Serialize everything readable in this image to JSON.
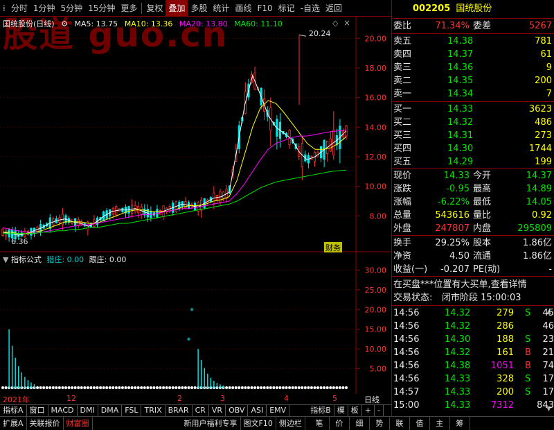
{
  "toolbar": {
    "items": [
      "分时",
      "1分钟",
      "5分钟",
      "15分钟",
      "更多",
      "复权",
      "叠加",
      "多股",
      "统计",
      "画线",
      "F10",
      "标记",
      "-自选",
      "返回"
    ]
  },
  "watermark": "股道 guo.cn",
  "chart_title": {
    "name": "国统股份(日线)",
    "ma5": "MA5: 13.75",
    "ma10": "MA10: 13.36",
    "ma20": "MA20: 13.80",
    "ma60": "MA60: 11.10"
  },
  "price_axis": [
    "20.00",
    "18.00",
    "16.00",
    "14.00",
    "12.00",
    "10.00",
    "8.00"
  ],
  "annotations": {
    "high": "20.24",
    "low": "6.36",
    "badge": "财务"
  },
  "indicator": {
    "title": "指标公式",
    "lie": "猎庄: 0.00",
    "gen": "跟庄: 0.00",
    "axis": [
      "30.00",
      "25.00",
      "20.00",
      "15.00",
      "10.00",
      "5.00"
    ]
  },
  "time_axis": {
    "labels": [
      "2021年",
      "12",
      "2",
      "3",
      "4",
      "5"
    ],
    "right": "日线"
  },
  "ind_tabs": [
    "指标A",
    "窗口",
    "MACD",
    "DMI",
    "DMA",
    "FSL",
    "TRIX",
    "BRAR",
    "CR",
    "VR",
    "OBV",
    "ASI",
    "EMV",
    "指标B",
    "模",
    "板",
    "+",
    "-"
  ],
  "bottom_bar": [
    "扩展A",
    "关联报价",
    "财富圈",
    "新用户福利专享",
    "图文F10",
    "侧边栏",
    "笔",
    "价",
    "细",
    "势",
    "联",
    "值",
    "主",
    "筹"
  ],
  "quote": {
    "code": "002205",
    "name": "国统股份",
    "weibi_label": "委比",
    "weibi": "71.34%",
    "weicha_label": "委差",
    "weicha": "5267",
    "asks": [
      {
        "label": "卖五",
        "price": "14.38",
        "vol": "781"
      },
      {
        "label": "卖四",
        "price": "14.37",
        "vol": "61"
      },
      {
        "label": "卖三",
        "price": "14.36",
        "vol": "9"
      },
      {
        "label": "卖二",
        "price": "14.35",
        "vol": "200"
      },
      {
        "label": "卖一",
        "price": "14.34",
        "vol": "7"
      }
    ],
    "bids": [
      {
        "label": "买一",
        "price": "14.33",
        "vol": "3623"
      },
      {
        "label": "买二",
        "price": "14.32",
        "vol": "486"
      },
      {
        "label": "买三",
        "price": "14.31",
        "vol": "273"
      },
      {
        "label": "买四",
        "price": "14.30",
        "vol": "1744"
      },
      {
        "label": "买五",
        "price": "14.29",
        "vol": "199"
      }
    ],
    "stats": [
      {
        "l1": "现价",
        "v1": "14.33",
        "c1": "green",
        "l2": "今开",
        "v2": "14.37",
        "c2": "green"
      },
      {
        "l1": "涨跌",
        "v1": "-0.95",
        "c1": "green",
        "l2": "最高",
        "v2": "14.89",
        "c2": "green"
      },
      {
        "l1": "涨幅",
        "v1": "-6.22%",
        "c1": "green",
        "l2": "最低",
        "v2": "14.05",
        "c2": "green"
      },
      {
        "l1": "总量",
        "v1": "543616",
        "c1": "yellow",
        "l2": "量比",
        "v2": "0.92",
        "c2": "yellow"
      },
      {
        "l1": "外盘",
        "v1": "247807",
        "c1": "red",
        "l2": "内盘",
        "v2": "295809",
        "c2": "green"
      }
    ],
    "stats2": [
      {
        "l1": "换手",
        "v1": "29.25%",
        "l2": "股本",
        "v2": "1.86亿"
      },
      {
        "l1": "净资",
        "v1": "4.50",
        "l2": "流通",
        "v2": "1.86亿"
      },
      {
        "l1": "收益(一)",
        "v1": "-0.207",
        "l2": "PE(动)",
        "v2": "-"
      }
    ],
    "notice": "在买盘***位置有大买单,查看详情",
    "status_label": "交易状态:",
    "status": "闭市阶段 15:00:03",
    "trades": [
      {
        "t": "14:56",
        "p": "14.32",
        "v": "279",
        "d": "S",
        "n": "45"
      },
      {
        "t": "14:56",
        "p": "14.32",
        "v": "286",
        "d": "",
        "n": "46"
      },
      {
        "t": "14:56",
        "p": "14.30",
        "v": "188",
        "d": "S",
        "n": "23"
      },
      {
        "t": "14:56",
        "p": "14.32",
        "v": "161",
        "d": "B",
        "n": "21"
      },
      {
        "t": "14:56",
        "p": "14.38",
        "v": "1051",
        "d": "B",
        "n": "74"
      },
      {
        "t": "14:56",
        "p": "14.33",
        "v": "328",
        "d": "S",
        "n": "17"
      },
      {
        "t": "14:57",
        "p": "14.33",
        "v": "200",
        "d": "S",
        "n": "17"
      },
      {
        "t": "15:00",
        "p": "14.33",
        "v": "7312",
        "d": "",
        "n": "843"
      }
    ]
  },
  "chart_data": {
    "type": "line",
    "y_range": [
      6,
      21
    ],
    "series": [
      {
        "name": "MA5",
        "values": [
          6.9,
          6.8,
          6.7,
          6.8,
          7.0,
          7.2,
          7.5,
          7.7,
          7.8,
          7.6,
          7.5,
          7.3,
          7.6,
          8.0,
          8.3,
          8.4,
          8.4,
          8.5,
          8.3,
          8.1,
          8.2,
          8.4,
          8.6,
          8.8,
          8.7,
          8.6,
          8.9,
          9.2,
          9.3,
          9.6,
          12.5,
          15.5,
          17.5,
          16.2,
          14.8,
          14.0,
          13.6,
          13.2,
          12.3,
          11.8,
          12.0,
          12.4,
          12.8,
          13.2,
          13.75
        ]
      },
      {
        "name": "MA10",
        "values": [
          6.9,
          6.9,
          6.8,
          6.8,
          6.9,
          7.0,
          7.2,
          7.4,
          7.6,
          7.6,
          7.6,
          7.5,
          7.5,
          7.7,
          7.9,
          8.1,
          8.3,
          8.4,
          8.4,
          8.3,
          8.3,
          8.3,
          8.4,
          8.6,
          8.7,
          8.7,
          8.8,
          9.0,
          9.1,
          9.3,
          10.4,
          12.2,
          14.0,
          15.3,
          15.8,
          15.6,
          15.0,
          14.3,
          13.6,
          12.9,
          12.5,
          12.5,
          12.6,
          12.9,
          13.36
        ]
      },
      {
        "name": "MA20",
        "values": [
          7.2,
          7.1,
          7.0,
          6.9,
          6.9,
          6.9,
          7.0,
          7.1,
          7.2,
          7.3,
          7.4,
          7.4,
          7.5,
          7.6,
          7.7,
          7.8,
          7.9,
          8.0,
          8.1,
          8.1,
          8.2,
          8.3,
          8.4,
          8.5,
          8.5,
          8.6,
          8.7,
          8.8,
          8.9,
          9.0,
          9.5,
          10.2,
          11.0,
          11.8,
          12.5,
          12.9,
          13.1,
          13.3,
          13.4,
          13.4,
          13.5,
          13.6,
          13.7,
          13.75,
          13.8
        ]
      },
      {
        "name": "MA60",
        "values": [
          6.8,
          6.8,
          6.8,
          6.8,
          6.8,
          6.9,
          6.9,
          7.0,
          7.0,
          7.1,
          7.1,
          7.2,
          7.2,
          7.3,
          7.4,
          7.5,
          7.5,
          7.6,
          7.7,
          7.8,
          7.9,
          8.0,
          8.1,
          8.2,
          8.3,
          8.4,
          8.5,
          8.6,
          8.7,
          8.8,
          9.0,
          9.3,
          9.6,
          9.9,
          10.1,
          10.3,
          10.4,
          10.5,
          10.6,
          10.7,
          10.8,
          10.9,
          11.0,
          11.05,
          11.1
        ]
      }
    ],
    "indicator_range": [
      0,
      32
    ],
    "indicator_spikes": [
      {
        "index": 2,
        "value": 15
      },
      {
        "index": 62,
        "value": 10
      }
    ],
    "indicator_dots": [
      {
        "index": 60,
        "value": 20
      },
      {
        "index": 59,
        "value": 12.5
      }
    ]
  }
}
